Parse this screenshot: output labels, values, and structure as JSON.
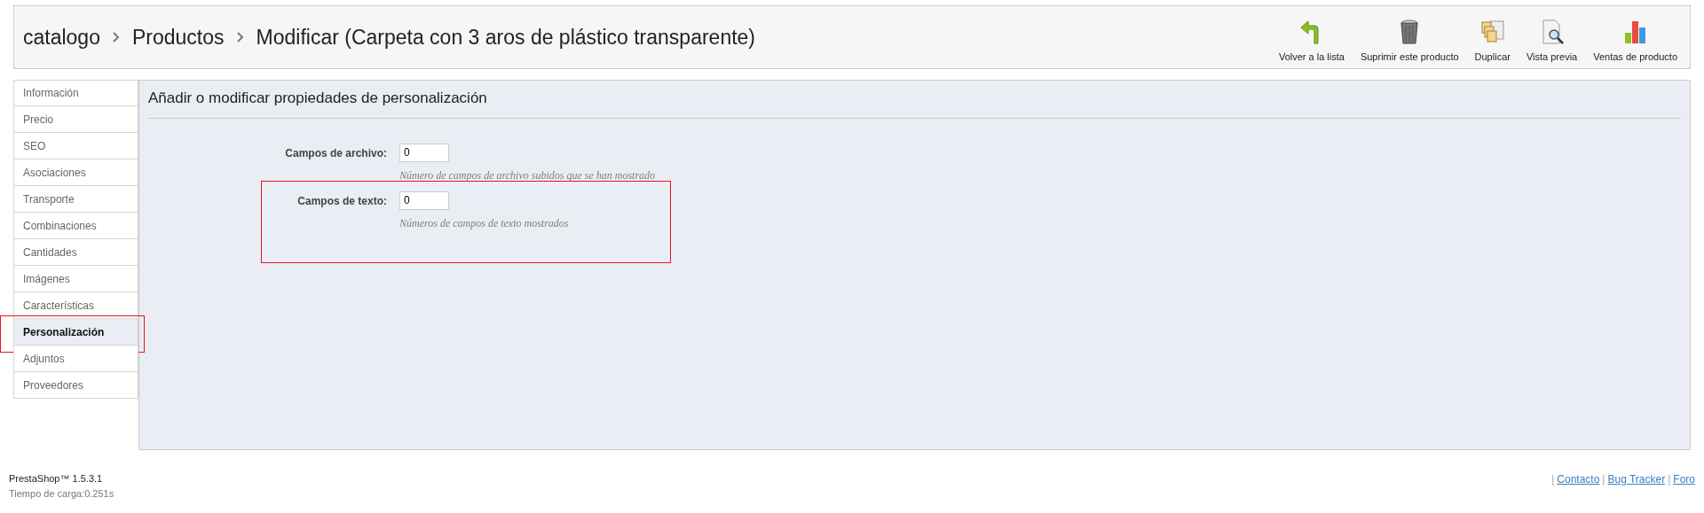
{
  "breadcrumbs": [
    "catalogo",
    "Productos",
    "Modificar (Carpeta con 3 aros de plástico transparente)"
  ],
  "toolbar": [
    {
      "label": "Volver a la lista",
      "kind": "back"
    },
    {
      "label": "Suprimir este producto",
      "kind": "delete"
    },
    {
      "label": "Duplicar",
      "kind": "duplicate"
    },
    {
      "label": "Vista previa",
      "kind": "preview"
    },
    {
      "label": "Ventas de producto",
      "kind": "sales"
    }
  ],
  "tabs": [
    {
      "label": "Información",
      "selected": false,
      "highlighted": false
    },
    {
      "label": "Precio",
      "selected": false,
      "highlighted": false
    },
    {
      "label": "SEO",
      "selected": false,
      "highlighted": false
    },
    {
      "label": "Asociaciones",
      "selected": false,
      "highlighted": false
    },
    {
      "label": "Transporte",
      "selected": false,
      "highlighted": false
    },
    {
      "label": "Combinaciones",
      "selected": false,
      "highlighted": false
    },
    {
      "label": "Cantidades",
      "selected": false,
      "highlighted": false
    },
    {
      "label": "Imágenes",
      "selected": false,
      "highlighted": false
    },
    {
      "label": "Características",
      "selected": false,
      "highlighted": false
    },
    {
      "label": "Personalización",
      "selected": true,
      "highlighted": true
    },
    {
      "label": "Adjuntos",
      "selected": false,
      "highlighted": false
    },
    {
      "label": "Proveedores",
      "selected": false,
      "highlighted": false
    }
  ],
  "panel": {
    "title": "Añadir o modificar propiedades de personalización",
    "fields": [
      {
        "label": "Campos de archivo:",
        "value": "0",
        "hint": "Número de campos de archivo subidos que se han mostrado",
        "highlighted": false
      },
      {
        "label": "Campos de texto:",
        "value": "0",
        "hint": "Números de campos de texto mostrados",
        "highlighted": true
      }
    ]
  },
  "footer": {
    "version": "PrestaShop™ 1.5.3.1",
    "load_time": "Tiempo de carga:0.251s",
    "separator": "|",
    "links": [
      "Contacto",
      "Bug Tracker",
      "Foro"
    ]
  }
}
